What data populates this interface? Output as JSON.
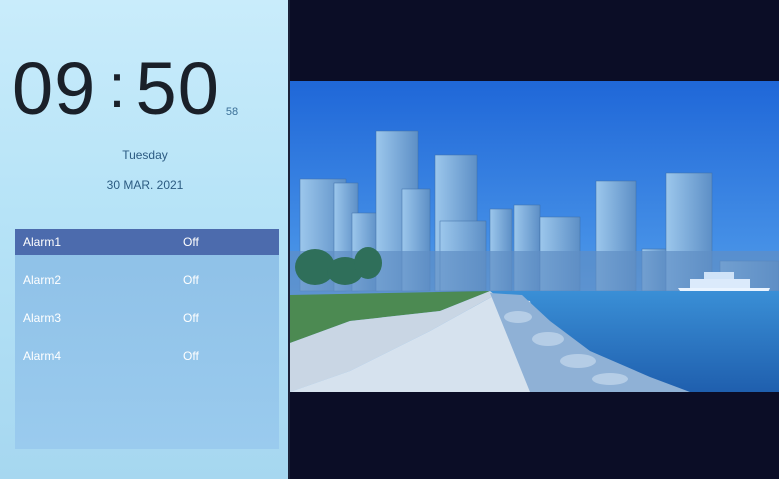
{
  "clock": {
    "hours": "09",
    "separator": ":",
    "minutes": "50",
    "seconds": "58",
    "weekday": "Tuesday",
    "date": "30 MAR. 2021"
  },
  "alarms": [
    {
      "name": "Alarm1",
      "state": "Off",
      "selected": true
    },
    {
      "name": "Alarm2",
      "state": "Off",
      "selected": false
    },
    {
      "name": "Alarm3",
      "state": "Off",
      "selected": false
    },
    {
      "name": "Alarm4",
      "state": "Off",
      "selected": false
    }
  ],
  "colors": {
    "panel_bg": "#b6e3f7",
    "alarm_box": "#8ec0e7",
    "alarm_selected": "#4c6bad",
    "clock_text": "#1a2029",
    "frame_bg": "#0b0d26"
  },
  "photo": {
    "subject": "city-skyline-waterfront-photo"
  }
}
